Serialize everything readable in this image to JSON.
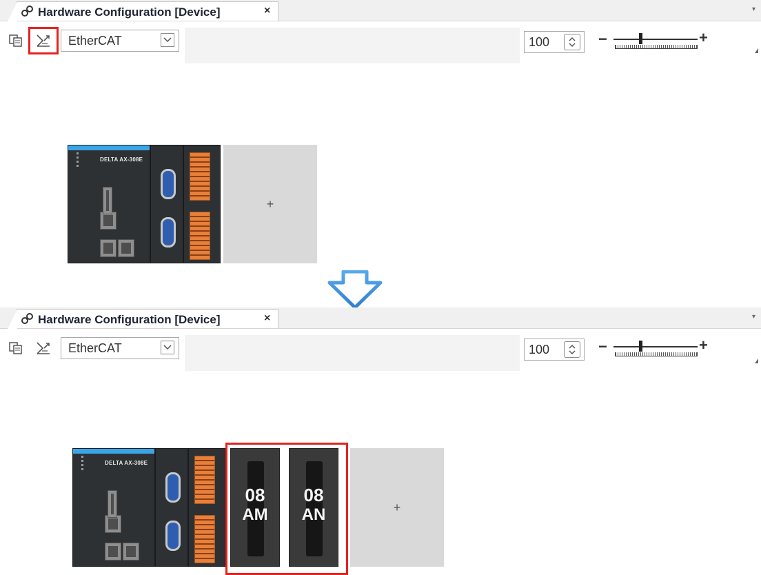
{
  "tab": {
    "title": "Hardware Configuration [Device]",
    "close": "×",
    "dropdown": "▾",
    "icon": "network-config-icon"
  },
  "toolbar": {
    "network_select_value": "EtherCAT",
    "zoom_value": "100",
    "slider_minus": "−",
    "slider_plus": "+",
    "zoom_slider_level": 0.3,
    "icons": [
      "module-view-icon",
      "auto-scan-icon",
      "chevron-down-icon",
      "spin-updown-icon"
    ]
  },
  "cpu": {
    "brand": "DELTA AX-308E"
  },
  "add_slot_label": "+",
  "modules": [
    {
      "line1": "08",
      "line2": "AM"
    },
    {
      "line1": "08",
      "line2": "AN"
    }
  ],
  "colors": {
    "highlight": "#e52320",
    "arrow": "#3d8fdb",
    "cpu_stripe": "#3aa6e8",
    "terminal": "#e8803a",
    "add_slot": "#d9d9d9"
  }
}
